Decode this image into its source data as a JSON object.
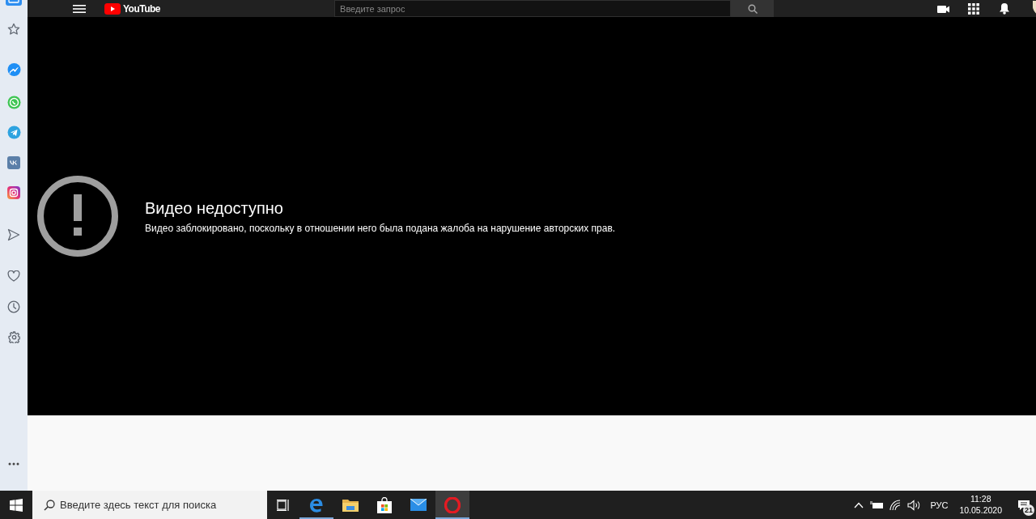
{
  "header": {
    "logo": {
      "text": "YouTube"
    },
    "search": {
      "placeholder": "Введите запрос"
    }
  },
  "player": {
    "title": "Видео недоступно",
    "message": "Видео заблокировано, поскольку в отношении него была подана жалоба на нарушение авторских прав."
  },
  "taskbar": {
    "search": {
      "placeholder": "Введите здесь текст для поиска"
    },
    "apps": [
      {
        "kind": "edge",
        "running": true,
        "selected": false
      },
      {
        "kind": "files",
        "running": false,
        "selected": false
      },
      {
        "kind": "store",
        "running": false,
        "selected": false
      },
      {
        "kind": "mail",
        "running": false,
        "selected": false
      },
      {
        "kind": "opera",
        "running": true,
        "selected": true
      }
    ],
    "tray": {
      "language": "РУС",
      "time": "11:28",
      "date": "10.05.2020",
      "notifications": "21"
    }
  }
}
